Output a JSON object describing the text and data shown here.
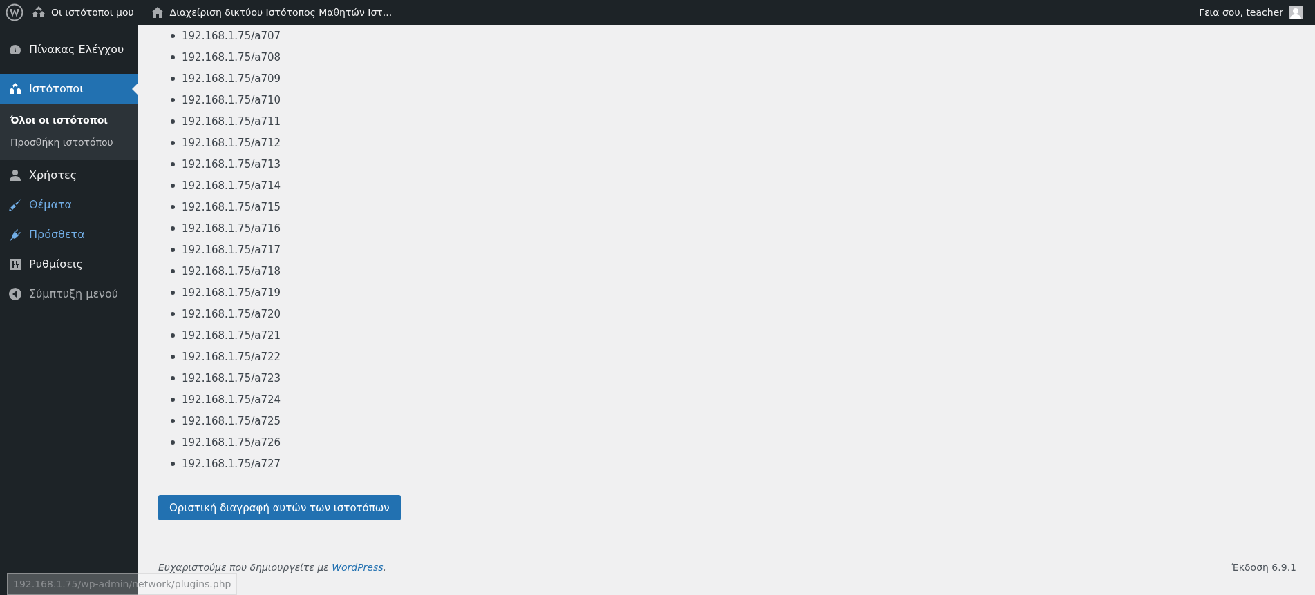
{
  "admin_bar": {
    "my_sites": "Οι ιστότοποι μου",
    "network_admin": "Διαχείριση δικτύου Ιστότοπος Μαθητών Ιστ...",
    "greeting": "Γεια σου, teacher"
  },
  "sidebar": {
    "items": [
      {
        "kind": "dashboard",
        "label": "Πίνακας Ελέγχου",
        "selected": false,
        "highlighted": false
      },
      {
        "kind": "sites",
        "label": "Ιστότοποι",
        "selected": true,
        "highlighted": false,
        "children": [
          {
            "label": "Όλοι οι ιστότοποι",
            "selected": true
          },
          {
            "label": "Προσθήκη ιστοτόπου",
            "selected": false
          }
        ]
      },
      {
        "kind": "users",
        "label": "Χρήστες",
        "selected": false,
        "highlighted": false
      },
      {
        "kind": "themes",
        "label": "Θέματα",
        "selected": false,
        "highlighted": true
      },
      {
        "kind": "plugins",
        "label": "Πρόσθετα",
        "selected": false,
        "highlighted": true
      },
      {
        "kind": "settings",
        "label": "Ρυθμίσεις",
        "selected": false,
        "highlighted": false
      },
      {
        "kind": "collapse",
        "label": "Σύμπτυξη μενού",
        "selected": false,
        "highlighted": false
      }
    ]
  },
  "sites": [
    "192.168.1.75/a707",
    "192.168.1.75/a708",
    "192.168.1.75/a709",
    "192.168.1.75/a710",
    "192.168.1.75/a711",
    "192.168.1.75/a712",
    "192.168.1.75/a713",
    "192.168.1.75/a714",
    "192.168.1.75/a715",
    "192.168.1.75/a716",
    "192.168.1.75/a717",
    "192.168.1.75/a718",
    "192.168.1.75/a719",
    "192.168.1.75/a720",
    "192.168.1.75/a721",
    "192.168.1.75/a722",
    "192.168.1.75/a723",
    "192.168.1.75/a724",
    "192.168.1.75/a725",
    "192.168.1.75/a726",
    "192.168.1.75/a727"
  ],
  "delete_button": "Οριστική διαγραφή αυτών των ιστοτόπων",
  "footer": {
    "thanks": "Ευχαριστούμε που δημιουργείτε με",
    "link": "WordPress",
    "period": ".",
    "version": "Έκδοση 6.9.1"
  },
  "status_url": "192.168.1.75/wp-admin/network/plugins.php"
}
